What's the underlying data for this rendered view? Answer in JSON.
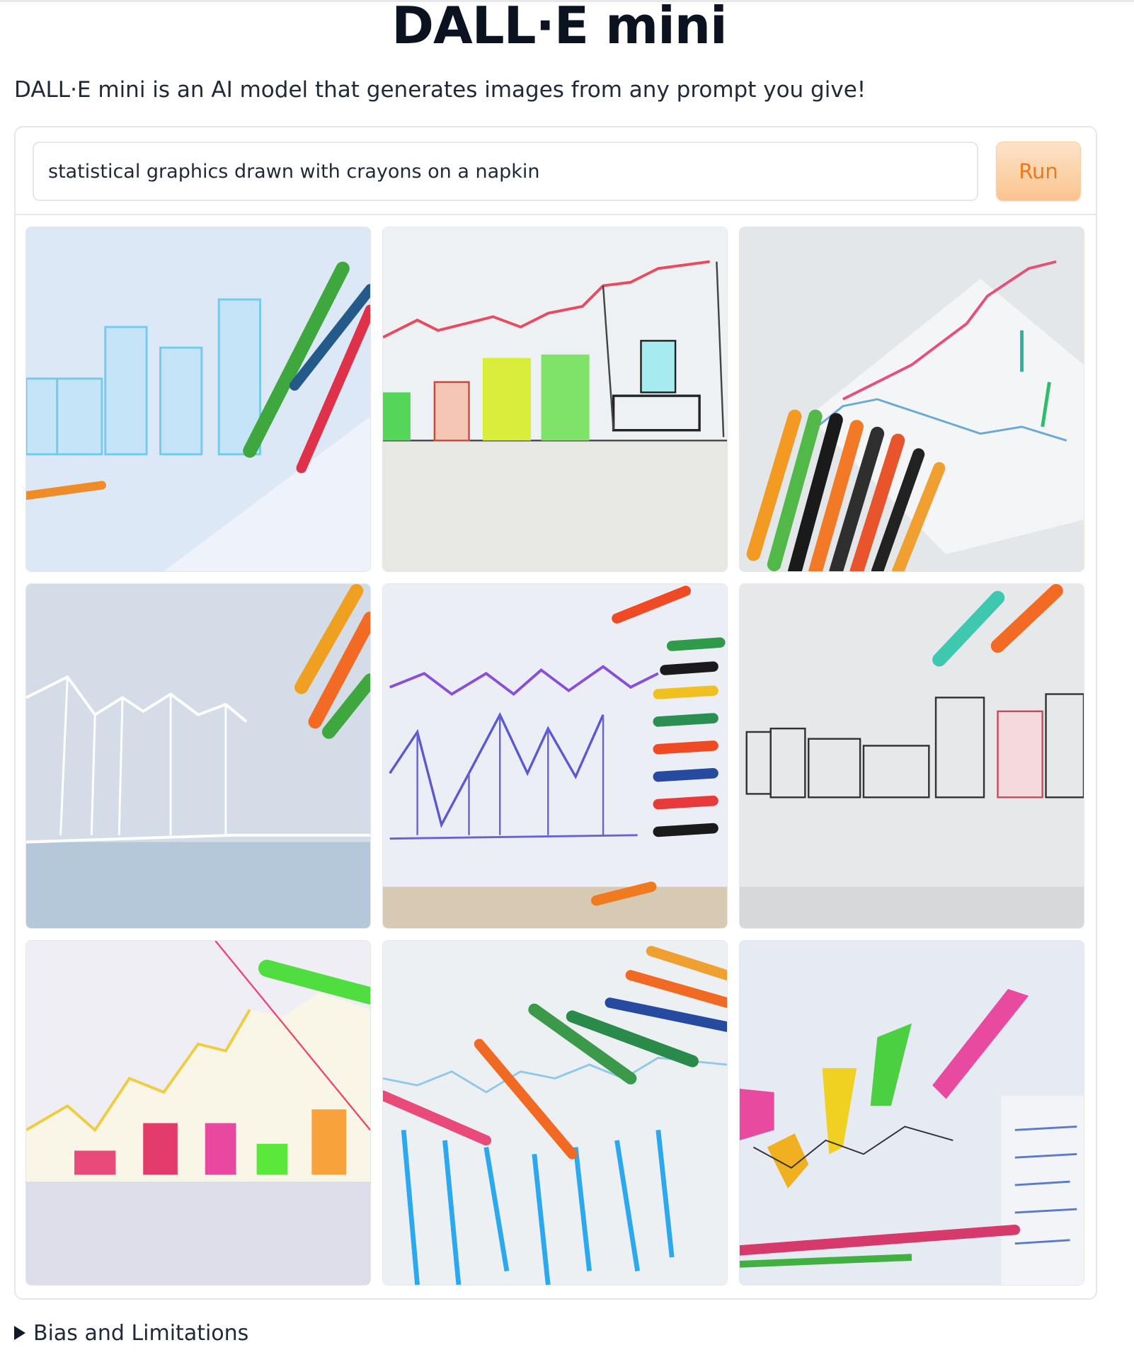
{
  "app": {
    "title": "DALL·E mini",
    "description": "DALL·E mini is an AI model that generates images from any prompt you give!"
  },
  "prompt": {
    "value": "statistical graphics drawn with crayons on a napkin"
  },
  "run_button": {
    "label": "Run"
  },
  "gallery": {
    "images": [
      {
        "subject": "crayon bar chart on napkin"
      },
      {
        "subject": "crayon bar and line chart"
      },
      {
        "subject": "crayon line chart with crayons"
      },
      {
        "subject": "white sketched bar chart with crayons"
      },
      {
        "subject": "blue zigzag line chart with crayons"
      },
      {
        "subject": "thin-line bar chart with crayon"
      },
      {
        "subject": "colored bars with line chart"
      },
      {
        "subject": "blue bars with crayons"
      },
      {
        "subject": "colored zigzag chart with notes"
      }
    ]
  },
  "accordion": {
    "label": "Bias and Limitations"
  },
  "colors": {
    "accent": "#ea7a1d",
    "run_bg": "#fbc38f",
    "border": "#e5e7eb",
    "title": "#0b1220"
  }
}
